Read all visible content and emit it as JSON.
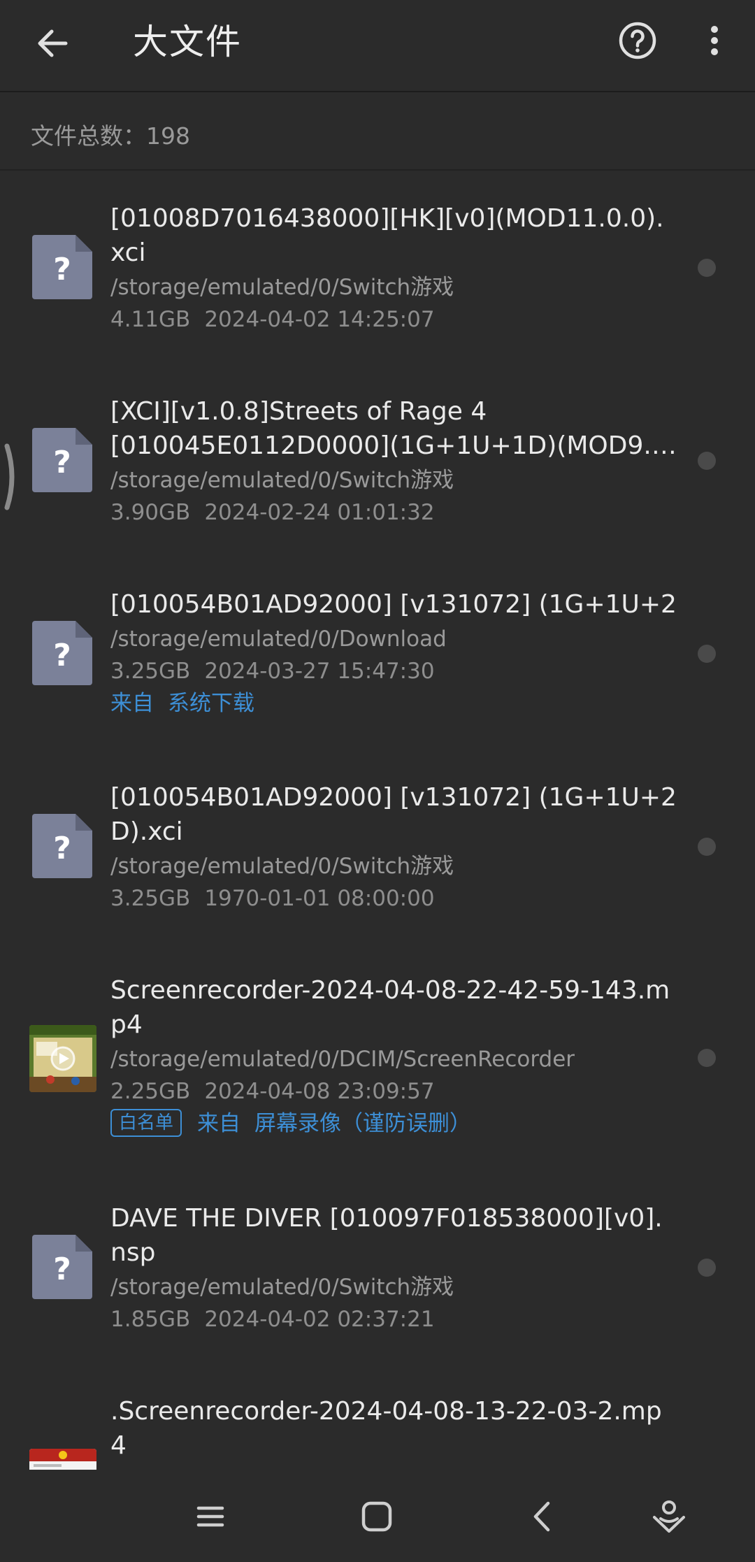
{
  "appbar": {
    "title": "大文件",
    "back_icon": "arrow-left-icon",
    "help_icon": "help-circle-icon",
    "more_icon": "more-vertical-icon"
  },
  "summary": {
    "count_text": "文件总数：198"
  },
  "files": [
    {
      "name": "[01008D7016438000][HK][v0](MOD11.0.0).xci",
      "path": "/storage/emulated/0/Switch游戏",
      "size": "4.11GB",
      "date": "2024-04-02 14:25:07",
      "icon": "unknown-file-icon"
    },
    {
      "name_line1": "[XCI][v1.0.8]Streets of Rage 4",
      "name_line2": "[010045E0112D0000](1G+1U+1D)(MOD9.2....",
      "path": "/storage/emulated/0/Switch游戏",
      "size": "3.90GB",
      "date": "2024-02-24 01:01:32",
      "icon": "unknown-file-icon"
    },
    {
      "name": "[010054B01AD92000] [v131072] (1G+1U+2",
      "path": "/storage/emulated/0/Download",
      "size": "3.25GB",
      "date": "2024-03-27 15:47:30",
      "source_from": "来自",
      "source_name": "系统下载",
      "icon": "unknown-file-icon"
    },
    {
      "name": "[010054B01AD92000] [v131072] (1G+1U+2D).xci",
      "path": "/storage/emulated/0/Switch游戏",
      "size": "3.25GB",
      "date": "1970-01-01 08:00:00",
      "icon": "unknown-file-icon"
    },
    {
      "name": "Screenrecorder-2024-04-08-22-42-59-143.mp4",
      "path": "/storage/emulated/0/DCIM/ScreenRecorder",
      "size": "2.25GB",
      "date": "2024-04-08 23:09:57",
      "badge": "白名单",
      "source_from": "来自",
      "source_name": "屏幕录像（谨防误删）",
      "icon": "video-thumbnail"
    },
    {
      "name": "DAVE THE DIVER [010097F018538000][v0].nsp",
      "path": "/storage/emulated/0/Switch游戏",
      "size": "1.85GB",
      "date": "2024-04-02 02:37:21",
      "icon": "unknown-file-icon"
    },
    {
      "name": ".Screenrecorder-2024-04-08-13-22-03-2.mp4",
      "icon": "video-thumbnail"
    }
  ],
  "navbar": {
    "icons": [
      "recent-apps-icon",
      "home-icon",
      "back-icon",
      "assistant-icon"
    ]
  },
  "colors": {
    "background": "#2b2b2b",
    "accent": "#3d8fd6",
    "file_icon": "#7b8199"
  }
}
